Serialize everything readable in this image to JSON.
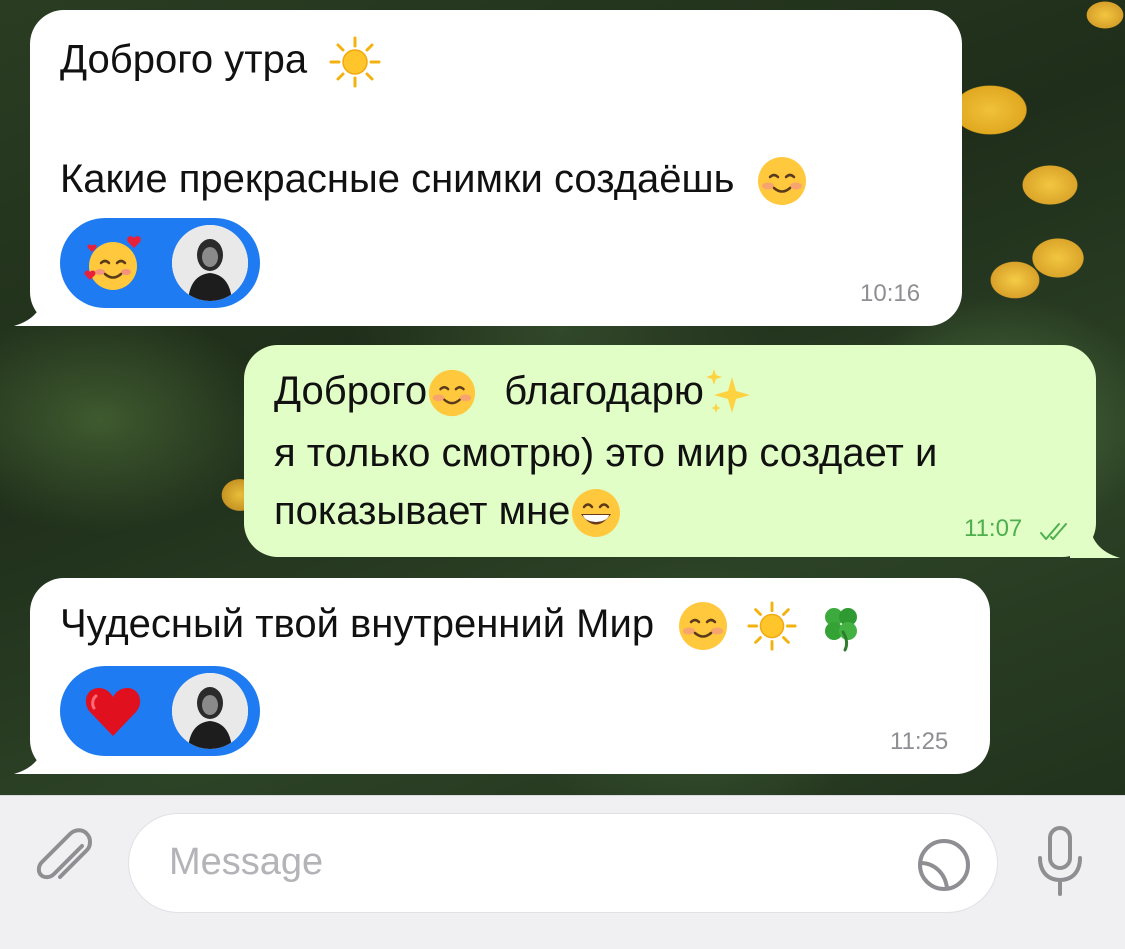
{
  "messages": [
    {
      "direction": "incoming",
      "line1": "Доброго утра",
      "line2": "Какие прекрасные снимки создаёшь",
      "reaction_icon": "smiling-face-with-hearts-icon",
      "time": "10:16"
    },
    {
      "direction": "outgoing",
      "line1_a": "Доброго",
      "line1_b": "благодарю",
      "line2": "я только смотрю) это мир создает и",
      "line3": "показывает мне",
      "time": "11:07",
      "status_icon": "double-check-icon"
    },
    {
      "direction": "incoming",
      "line1": "Чудесный твой внутренний Мир",
      "reaction_icon": "red-heart-icon",
      "time": "11:25"
    }
  ],
  "input": {
    "placeholder": "Message"
  },
  "colors": {
    "incoming_bubble": "#ffffff",
    "outgoing_bubble": "#e1fec6",
    "reaction_pill": "#1f7bf2",
    "outgoing_time": "#4fae4e",
    "input_bar": "#f0f0f3"
  }
}
